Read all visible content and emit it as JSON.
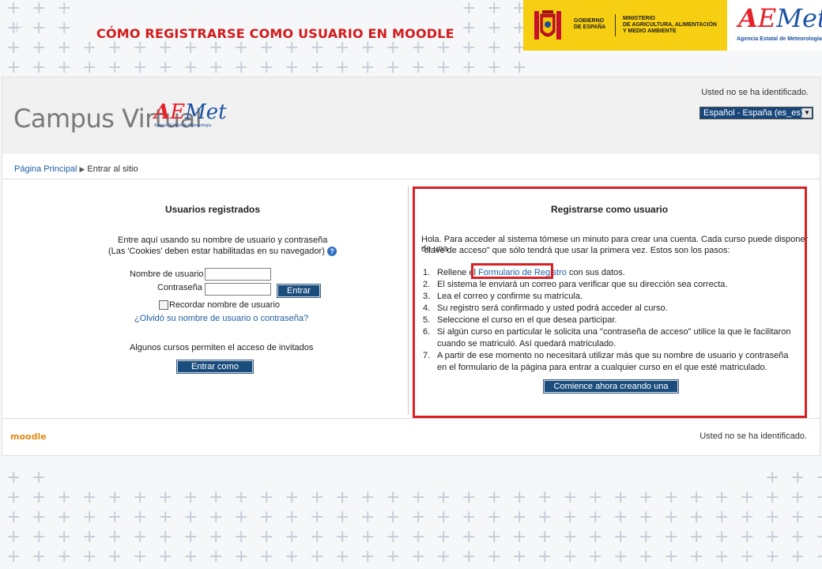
{
  "slide": {
    "title": "CÓMO REGISTRARSE COMO USUARIO EN MOODLE",
    "gov_left": [
      "GOBIERNO",
      "DE ESPAÑA"
    ],
    "gov_right": [
      "MINISTERIO",
      "DE AGRICULTURA, ALIMENTACIÓN",
      "Y MEDIO AMBIENTE"
    ],
    "aemet_word": "Met",
    "aemet_sub": "Agencia Estatal de Meteorología"
  },
  "header": {
    "campus_title": "Campus Virtual",
    "logo_word": "Met",
    "logo_sub": "Agencia Estatal de Meteorología",
    "login_status": "Usted no se ha identificado.",
    "language": "Español - España (es_es)"
  },
  "breadcrumb": {
    "home": "Página Principal",
    "current": "Entrar al sitio"
  },
  "login": {
    "heading": "Usuarios registrados",
    "intro_line1": "Entre aquí usando su nombre de usuario y contraseña",
    "intro_line2": "(Las 'Cookies' deben estar habilitadas en su navegador)",
    "username_label": "Nombre de usuario",
    "password_label": "Contraseña",
    "submit_label": "Entrar",
    "remember_label": "Recordar nombre de usuario",
    "forgot_link": "¿Olvidó su nombre de usuario o contraseña?",
    "guest_note": "Algunos cursos permiten el acceso de invitados",
    "guest_button": "Entrar como invitado"
  },
  "signup": {
    "heading": "Registrarse como usuario",
    "intro_line1": "Hola. Para acceder al sistema tómese un minuto para crear una cuenta. Cada curso puede disponer de una",
    "intro_line2": "\"clave de acceso\" que sólo tendrá que usar la primera vez. Estos son los pasos:",
    "step1_pre": "Rellene el ",
    "step1_link": "Formulario de Registro",
    "step1_post": " con sus datos.",
    "steps": [
      {
        "num": "2.",
        "text": "El sistema le enviará un correo para verificar que su dirección sea correcta."
      },
      {
        "num": "3.",
        "text": "Lea el correo y confirme su matrícula."
      },
      {
        "num": "4.",
        "text": "Su registro será confirmado y usted podrá acceder al curso."
      },
      {
        "num": "5.",
        "text": "Seleccione el curso en el que desea participar."
      },
      {
        "num": "6.",
        "text": "Si algún curso en particular le solicita una \"contraseña de acceso\" utilice la que le facilitaron cuando se matriculó. Así quedará matriculado."
      },
      {
        "num": "7.",
        "text": "A partir de ese momento no necesitará utilizar más que su nombre de usuario y contraseña en el formulario de la página para entrar a cualquier curso en el que esté matriculado."
      }
    ],
    "cta_button": "Comience ahora creando una cuenta"
  },
  "footer": {
    "moodle": "moodle",
    "login_status": "Usted no se ha identificado."
  }
}
